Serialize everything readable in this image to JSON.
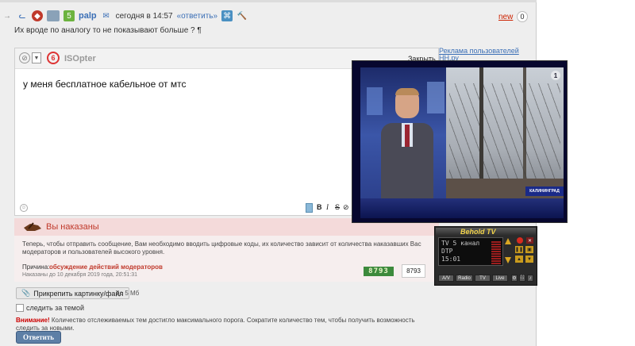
{
  "post": {
    "author": "palp",
    "time": "сегодня в 14:57",
    "reply_link": "«ответить»",
    "new_label": "new",
    "count": "0",
    "text": "Их вроде по аналогу то не показывают больше ? ¶"
  },
  "editor": {
    "username": "ISOpter",
    "close_label": "Закрыть",
    "text": "у меня бесплатное кабельное от мтс",
    "format_buttons": [
      "B",
      "I",
      "S"
    ]
  },
  "sidebar": {
    "ad_link": "Реклама пользователей НН.ру"
  },
  "tv_window": {
    "caption": "КАЛИНИНГРАД",
    "channel_logo": "1"
  },
  "punishment": {
    "title": "Вы наказаны",
    "message": "Теперь, чтобы отправить сообщение, Вам необходимо вводить цифровые коды, их количество зависит от количества наказавших Вас модераторов и пользователей высокого уровня.",
    "reason_label": "Причина:",
    "reason_link": "обсуждение действий модераторов",
    "punished_until": "Наказаны до 10 декабря 2019 года, 20:51:31",
    "captcha_code": "8793",
    "captcha_value": "8793"
  },
  "behold_tv": {
    "title": "Behold TV",
    "lcd_line1": "TV  5 канал",
    "lcd_line2": "DTP",
    "lcd_line3": "15:01",
    "buttons": [
      "A/V",
      "Radio",
      "TV",
      "Live"
    ]
  },
  "attach": {
    "button_label": "Прикрепить картинку/файл",
    "size_limit": "до 5 Мб"
  },
  "follow_label": "следить за темой",
  "warning": {
    "label": "Внимание!",
    "text": "Количество отслеживаемых тем достигло максимального порога. Сократите количество тем, чтобы получить возможность следить за новыми."
  },
  "submit_label": "Ответить",
  "colors": {
    "link": "#3b6fb6",
    "alert": "#cc2200",
    "submit": "#5d7fa6"
  }
}
